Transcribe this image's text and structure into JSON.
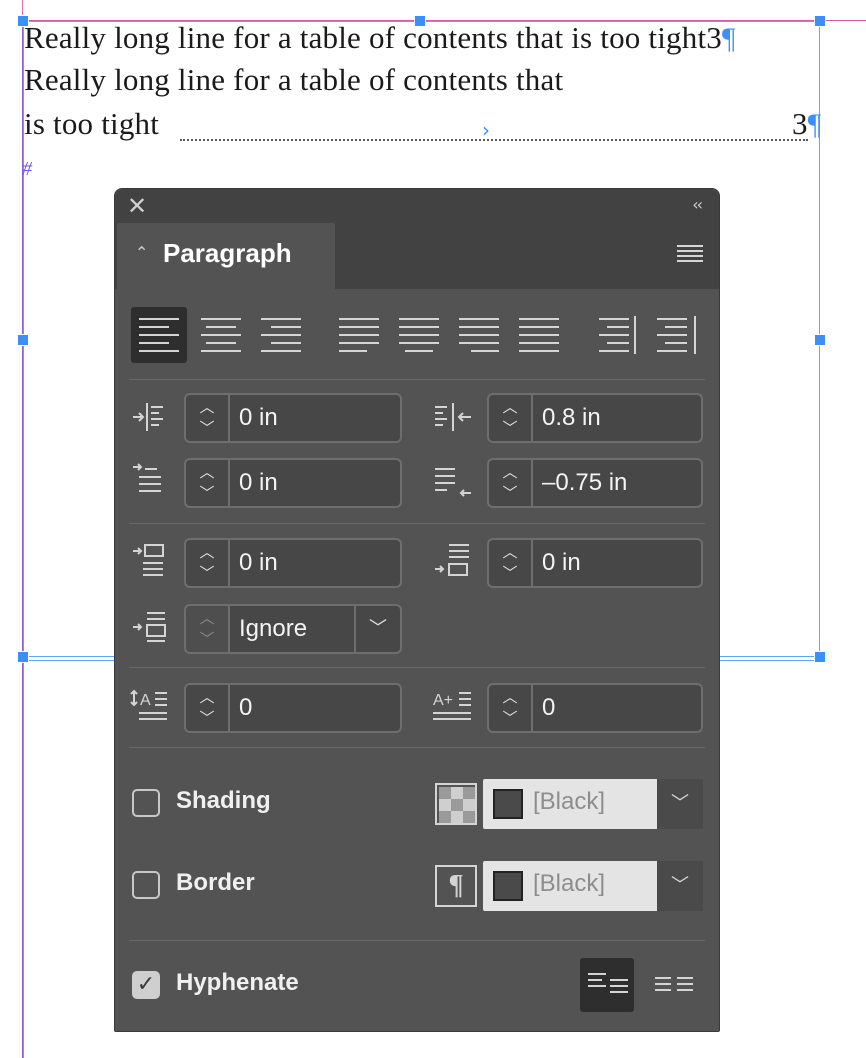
{
  "document": {
    "line1": "Really long line for a table of contents that is too tight",
    "line1_page": "3",
    "line2": "Really long line for a table of contents that",
    "line3": "is too tight",
    "line3_page": "3",
    "pilcrow": "¶",
    "hash": "#"
  },
  "panel": {
    "title": "Paragraph",
    "close_glyph": "✕",
    "collapse_glyph": "‹‹",
    "alignment_buttons": [
      {
        "name": "align-left",
        "active": true
      },
      {
        "name": "align-center",
        "active": false
      },
      {
        "name": "align-right",
        "active": false
      },
      {
        "name": "justify-left",
        "active": false
      },
      {
        "name": "justify-center",
        "active": false
      },
      {
        "name": "justify-right",
        "active": false
      },
      {
        "name": "justify-all",
        "active": false
      },
      {
        "name": "align-toward-spine",
        "active": false
      },
      {
        "name": "align-away-from-spine",
        "active": false
      }
    ],
    "left_indent": "0 in",
    "right_indent": "0.8 in",
    "first_line_indent": "0 in",
    "last_line_right_indent": "–0.75 in",
    "space_before": "0 in",
    "space_after": "0 in",
    "align_to_grid": "Ignore",
    "drop_cap_lines": "0",
    "drop_cap_characters": "0",
    "shading_label": "Shading",
    "shading_checked": false,
    "shading_swatch": "[Black]",
    "border_label": "Border",
    "border_checked": false,
    "border_swatch": "[Black]",
    "hyphenate_label": "Hyphenate",
    "hyphenate_checked": true,
    "check_glyph": "✓"
  }
}
